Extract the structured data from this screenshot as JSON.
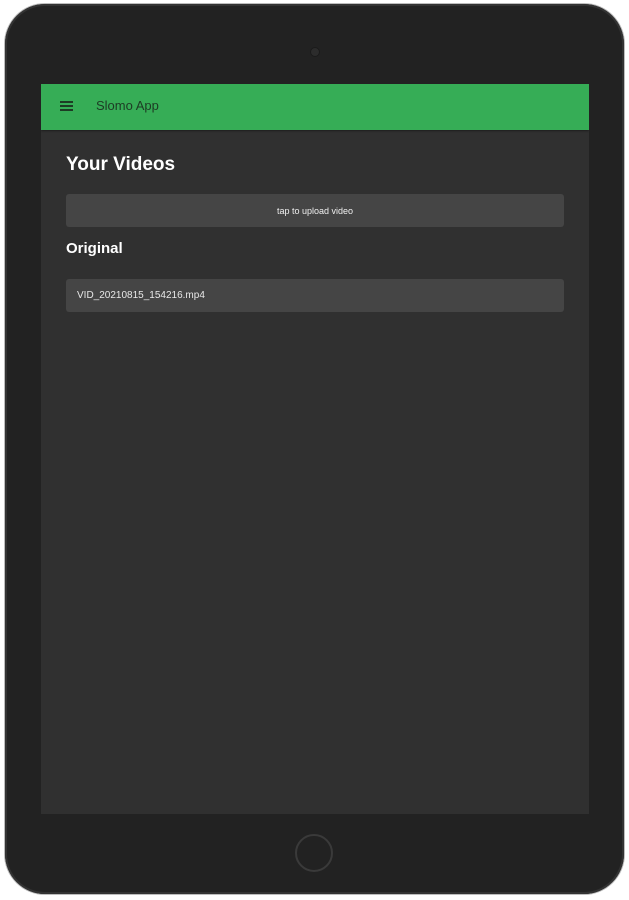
{
  "app_bar": {
    "title": "Slomo App",
    "menu_icon": "hamburger-menu-icon",
    "color": "#36ad56"
  },
  "page": {
    "title": "Your Videos",
    "upload_label": "tap to upload video"
  },
  "sections": [
    {
      "title": "Original",
      "items": [
        {
          "label": "VID_20210815_154216.mp4"
        }
      ]
    }
  ]
}
